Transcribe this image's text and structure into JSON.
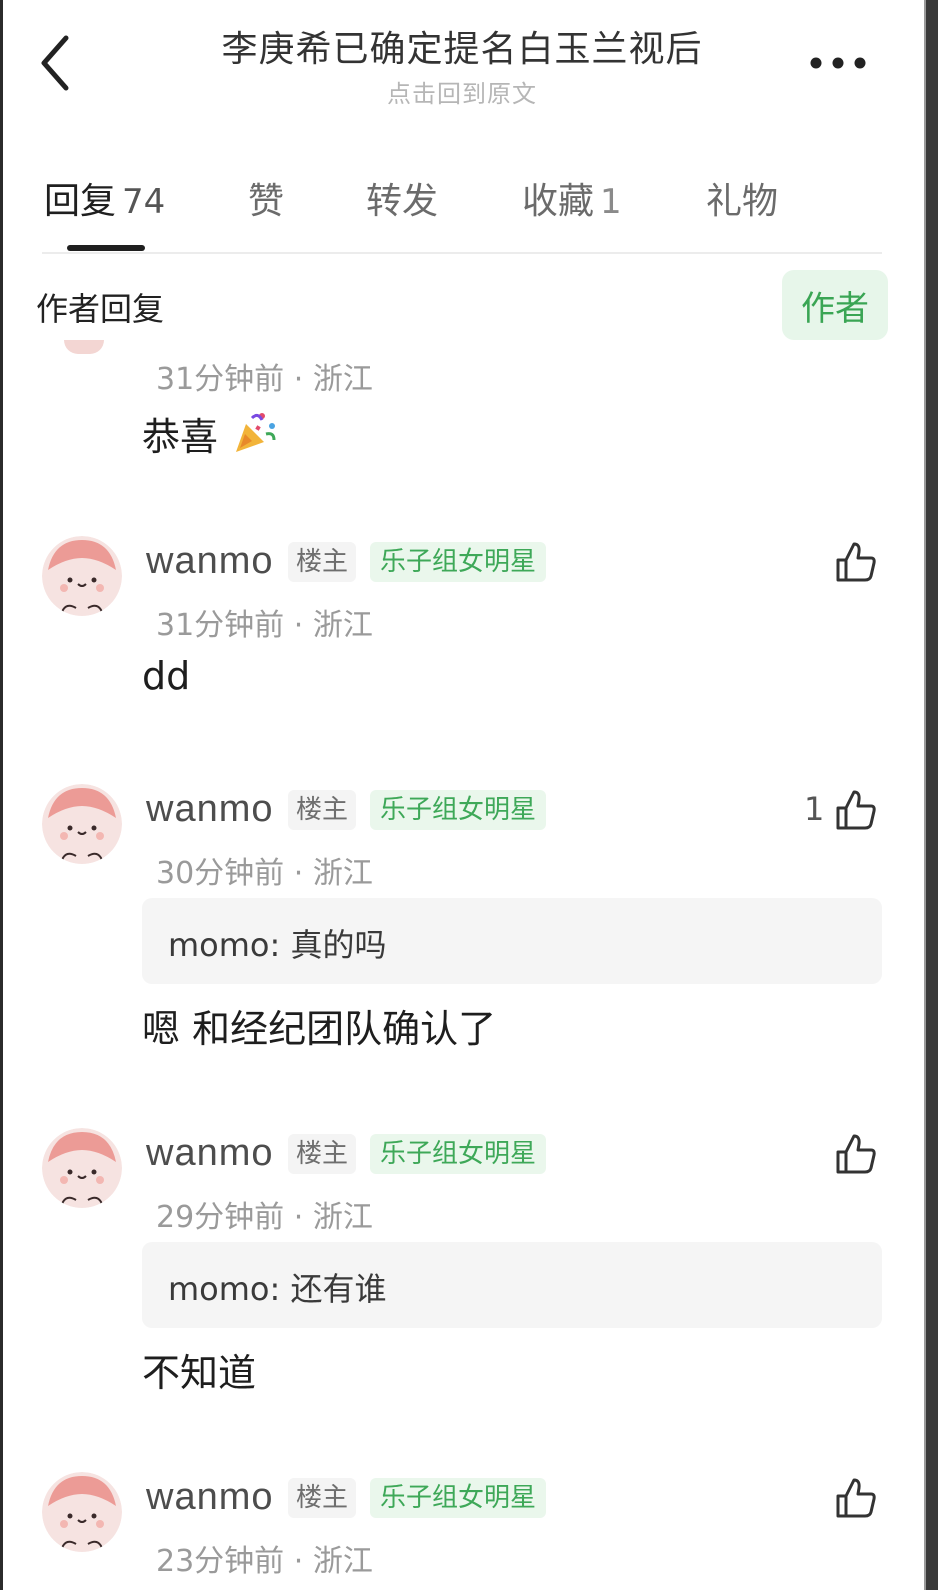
{
  "header": {
    "title": "李庚希已确定提名白玉兰视后",
    "subtitle": "点击回到原文"
  },
  "tabs": [
    {
      "label": "回复",
      "count": "74"
    },
    {
      "label": "赞",
      "count": ""
    },
    {
      "label": "转发",
      "count": ""
    },
    {
      "label": "收藏",
      "count": "1"
    },
    {
      "label": "礼物",
      "count": ""
    }
  ],
  "section": {
    "label": "作者回复",
    "filter": "作者"
  },
  "comments": [
    {
      "time": "31分钟前",
      "place": "浙江",
      "text": "恭喜"
    },
    {
      "user": "wanmo",
      "owner": "楼主",
      "tag": "乐子组女明星",
      "time": "31分钟前",
      "place": "浙江",
      "text": "dd",
      "likes": ""
    },
    {
      "user": "wanmo",
      "owner": "楼主",
      "tag": "乐子组女明星",
      "time": "30分钟前",
      "place": "浙江",
      "quote": "momo: 真的吗",
      "text": "嗯 和经纪团队确认了",
      "likes": "1"
    },
    {
      "user": "wanmo",
      "owner": "楼主",
      "tag": "乐子组女明星",
      "time": "29分钟前",
      "place": "浙江",
      "quote": "momo: 还有谁",
      "text": "不知道",
      "likes": ""
    },
    {
      "user": "wanmo",
      "owner": "楼主",
      "tag": "乐子组女明星",
      "time": "23分钟前",
      "place": "浙江",
      "likes": ""
    }
  ],
  "meta_sep": "·",
  "colors": {
    "accent_green": "#3ea858",
    "tag_bg": "#eaf7ec",
    "muted": "#9a9a9a"
  },
  "icons": [
    "back-icon",
    "more-icon",
    "thumbs-up-icon",
    "party-popper-icon"
  ]
}
